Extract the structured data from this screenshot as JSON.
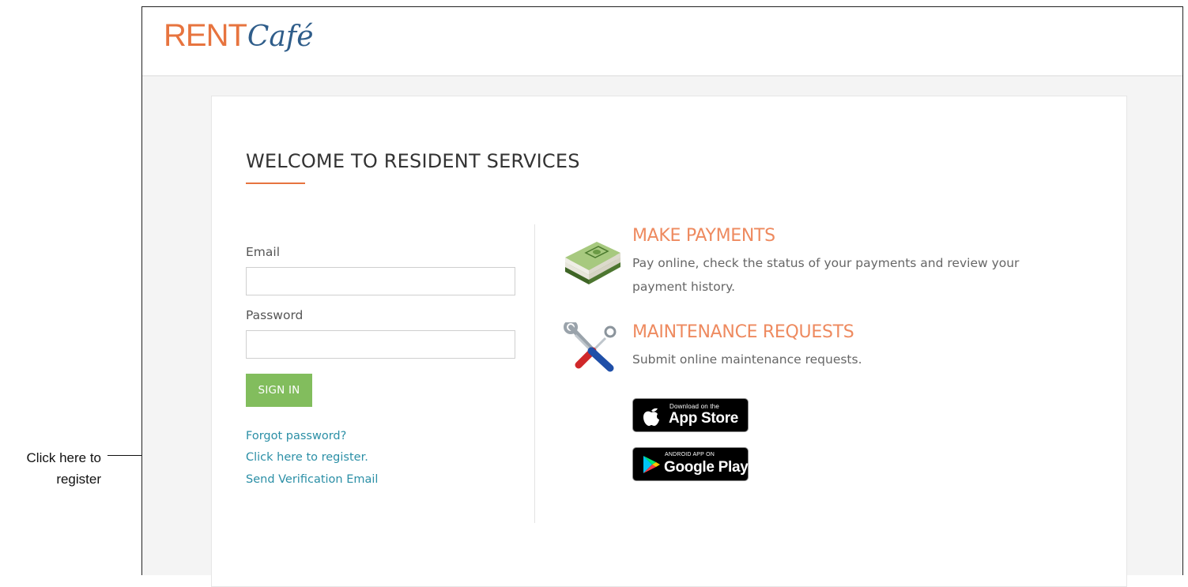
{
  "annotation": {
    "callout_text": "Click here to register"
  },
  "header": {
    "logo_rent": "RENT",
    "logo_cafe": "Café"
  },
  "page": {
    "title": "WELCOME TO RESIDENT SERVICES"
  },
  "login": {
    "email_label": "Email",
    "email_value": "",
    "password_label": "Password",
    "password_value": "",
    "signin_label": "SIGN IN",
    "forgot_link": "Forgot password?",
    "register_link": "Click here to register.",
    "verify_link": "Send Verification Email"
  },
  "features": [
    {
      "icon": "money-stack-icon",
      "title": "MAKE PAYMENTS",
      "description": "Pay online, check the status of your payments and review your payment history."
    },
    {
      "icon": "tools-icon",
      "title": "MAINTENANCE REQUESTS",
      "description": "Submit online maintenance requests."
    }
  ],
  "app_badges": {
    "apple_small": "Download on the",
    "apple_big": "App Store",
    "google_small": "ANDROID APP ON",
    "google_big": "Google Play"
  },
  "colors": {
    "accent_orange": "#e7743f",
    "logo_blue": "#2f5d8a",
    "signin_green": "#82bd5d",
    "link_teal": "#2b8fa6",
    "feature_title": "#ee8a5f"
  }
}
